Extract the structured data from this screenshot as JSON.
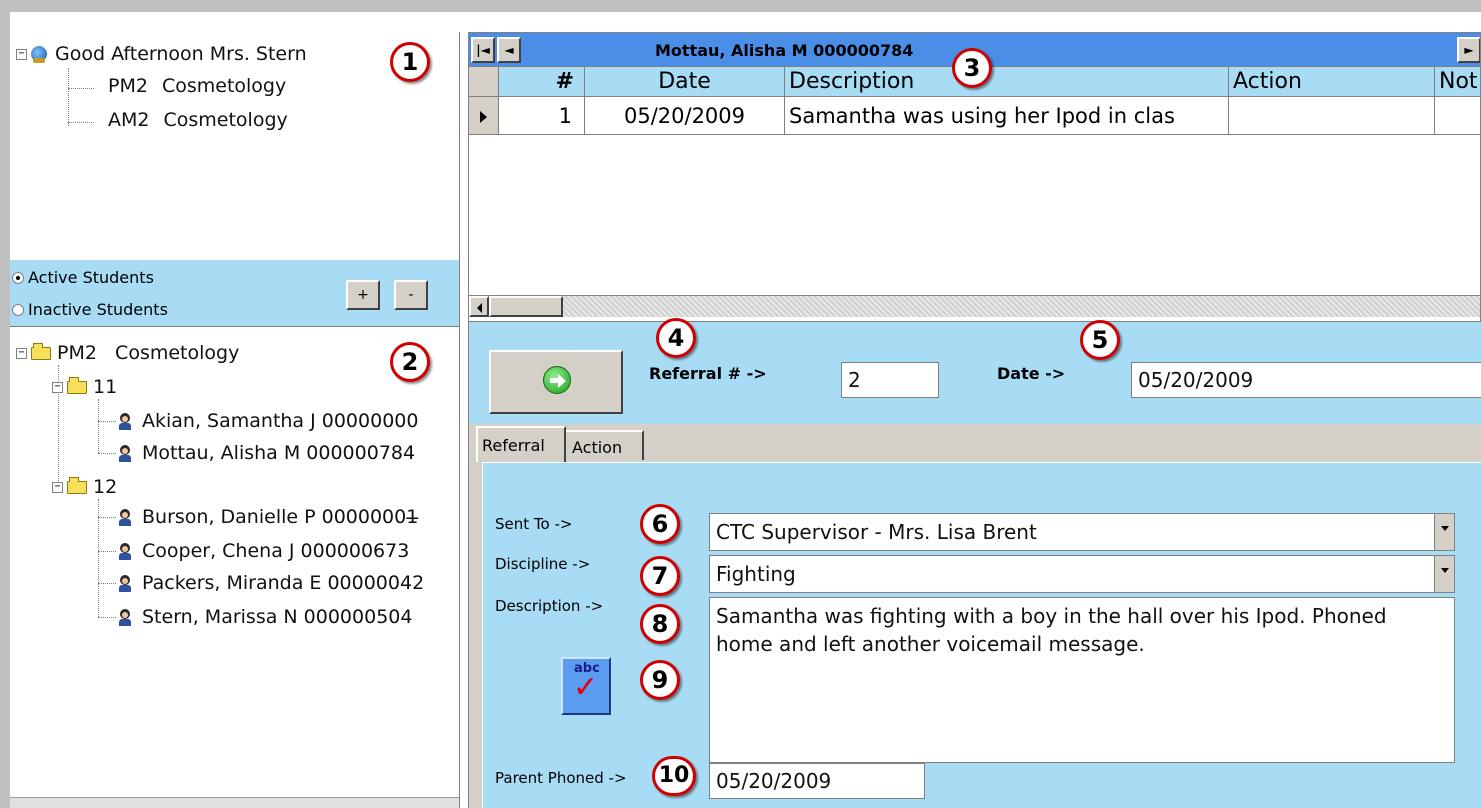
{
  "classes_tree": {
    "root_label": "Good Afternoon Mrs. Stern",
    "items": [
      {
        "code": "PM2",
        "name": "Cosmetology"
      },
      {
        "code": "AM2",
        "name": "Cosmetology"
      }
    ]
  },
  "filter": {
    "active_label": "Active Students",
    "inactive_label": "Inactive Students",
    "selected": "Active Students",
    "plus_label": "+",
    "minus_label": "-"
  },
  "students_tree": {
    "root_label": "PM2   Cosmetology",
    "groups": [
      {
        "label": "11",
        "students": [
          "Akian, Samantha J 00000000",
          "Mottau, Alisha M 000000784"
        ]
      },
      {
        "label": "12",
        "students": [
          "Burson, Danielle P 00000001̶",
          "Cooper, Chena J 000000673",
          "Packers, Miranda E 00000042",
          "Stern, Marissa N 000000504"
        ]
      }
    ]
  },
  "grid": {
    "title": "Mottau, Alisha M 000000784",
    "nav_first": "|◄",
    "nav_prev": "◄",
    "nav_next": "►",
    "columns": [
      "#",
      "Date",
      "Description",
      "Action",
      "Not"
    ],
    "rows": [
      {
        "num": "1",
        "date": "05/20/2009",
        "description": "Samantha was using her Ipod in clas",
        "action": "",
        "notes": ""
      }
    ]
  },
  "referral": {
    "number_label": "Referral # ->",
    "number_value": "2",
    "date_label": "Date ->",
    "date_value": "05/20/2009"
  },
  "tabs": [
    {
      "label": "Referral",
      "active": true
    },
    {
      "label": "Action",
      "active": false
    }
  ],
  "form": {
    "sent_to_label": "Sent To ->",
    "sent_to_value": "CTC Supervisor - Mrs. Lisa Brent",
    "discipline_label": "Discipline ->",
    "discipline_value": "Fighting",
    "description_label": "Description ->",
    "description_value": "Samantha was fighting with a boy in the hall over his Ipod. Phoned home and left another voicemail message.",
    "spellcheck_icon_text": "abc",
    "parent_phoned_label": "Parent Phoned ->",
    "parent_phoned_value": "05/20/2009"
  },
  "callouts": [
    "1",
    "2",
    "3",
    "4",
    "5",
    "6",
    "7",
    "8",
    "9",
    "10"
  ],
  "colors": {
    "panel_blue": "#a8dcf5",
    "header_blue": "#4a8ee8",
    "callout_red": "#d00000"
  }
}
